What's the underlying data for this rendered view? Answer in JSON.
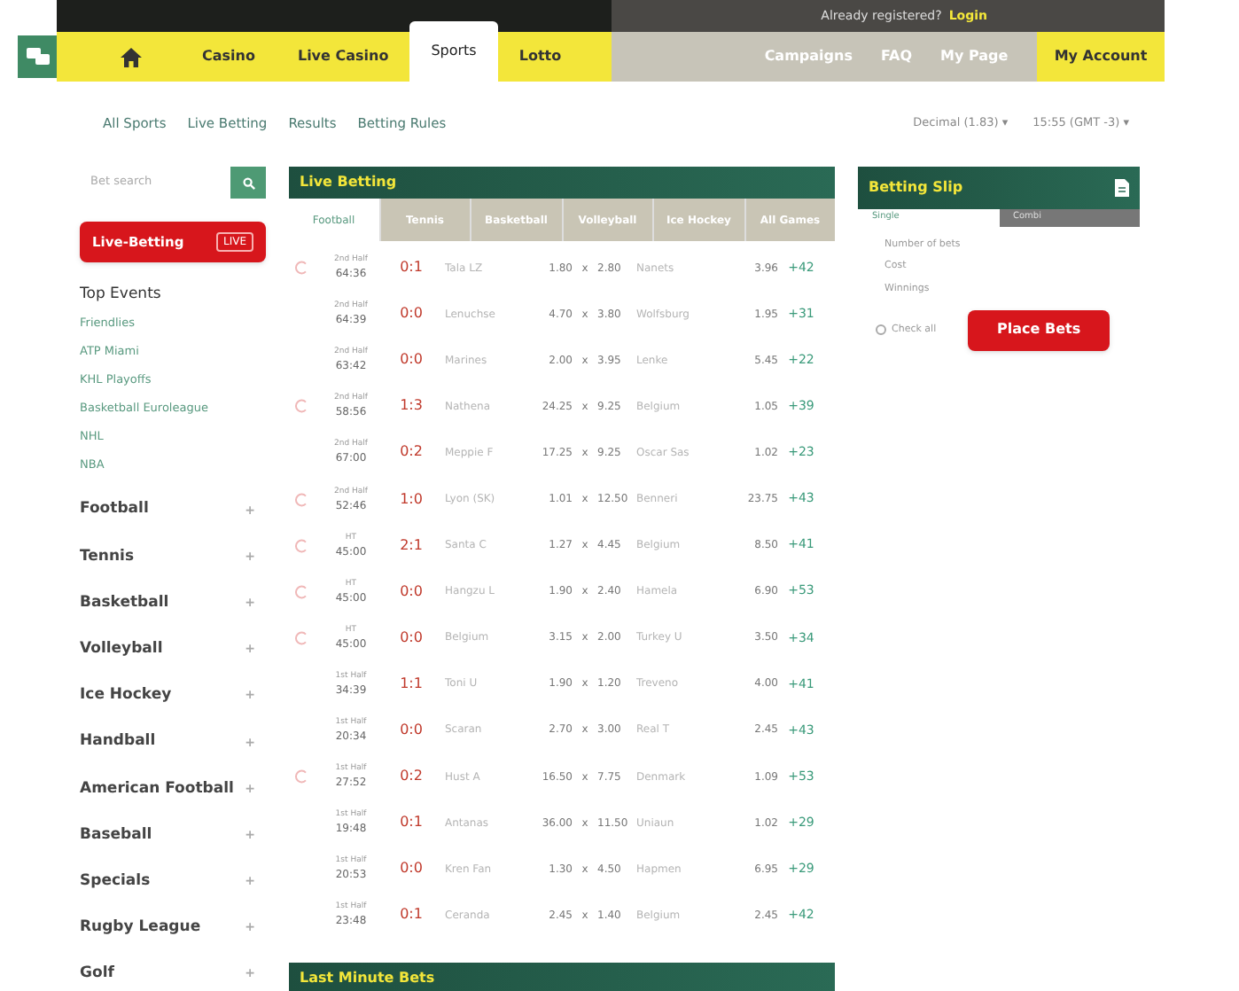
{
  "header": {
    "login_prompt": "Already registered?",
    "login_link": "Login"
  },
  "nav": {
    "main": [
      {
        "kind": "home",
        "selected": false
      },
      {
        "kind": "link",
        "label": "Casino",
        "selected": false
      },
      {
        "kind": "link",
        "label": "Live Casino",
        "selected": false
      },
      {
        "kind": "link",
        "label": "Sports",
        "selected": true
      },
      {
        "kind": "link",
        "label": "Lotto",
        "selected": false
      }
    ],
    "secondary": [
      "Campaigns",
      "FAQ",
      "My Page"
    ],
    "account": "My Account"
  },
  "subnav": {
    "links": [
      "All Sports",
      "Live Betting",
      "Results",
      "Betting Rules"
    ],
    "odds_format": "Decimal (1.83)",
    "odds_caret": "▾",
    "timezone": "15:55 (GMT -3)",
    "timezone_caret": "▾"
  },
  "sidebar": {
    "search": {
      "placeholder": "Bet search"
    },
    "live_button": {
      "label": "Live-Betting",
      "badge": "LIVE"
    },
    "top_events_title": "Top Events",
    "top_events": [
      "Friendlies",
      "ATP Miami",
      "KHL Playoffs",
      "Basketball Euroleague",
      "NHL",
      "NBA"
    ],
    "sports": [
      {
        "label": "Football",
        "expand": "+"
      },
      {
        "label": "Tennis",
        "expand": "+"
      },
      {
        "label": "Basketball",
        "expand": "+"
      },
      {
        "label": "Volleyball",
        "expand": "+"
      },
      {
        "label": "Ice Hockey",
        "expand": "+"
      },
      {
        "label": "Handball",
        "expand": "+"
      },
      {
        "label": "American Football",
        "expand": "+"
      },
      {
        "label": "Baseball",
        "expand": "+"
      },
      {
        "label": "Specials",
        "expand": "+"
      },
      {
        "label": "Rugby League",
        "expand": "+"
      },
      {
        "label": "Golf",
        "expand": "+"
      }
    ]
  },
  "live_betting": {
    "title": "Live Betting",
    "tabs": [
      {
        "label": "Football",
        "selected": true
      },
      {
        "label": "Tennis",
        "selected": false
      },
      {
        "label": "Basketball",
        "selected": false
      },
      {
        "label": "Volleyball",
        "selected": false
      },
      {
        "label": "Ice Hockey",
        "selected": false
      },
      {
        "label": "All Games",
        "selected": false
      }
    ],
    "rows": [
      {
        "stream": true,
        "period": "2nd Half",
        "clock": "64:36",
        "score": "0:1",
        "home": "Tala LZ",
        "odd1": "1.80",
        "x": "x",
        "oddx": "2.80",
        "away": "Nanets",
        "odd2": "3.96",
        "more": "+42"
      },
      {
        "stream": false,
        "period": "2nd Half",
        "clock": "64:39",
        "score": "0:0",
        "home": "Lenuchse",
        "odd1": "4.70",
        "x": "x",
        "oddx": "3.80",
        "away": "Wolfsburg",
        "odd2": "1.95",
        "more": "+31"
      },
      {
        "stream": false,
        "period": "2nd Half",
        "clock": "63:42",
        "score": "0:0",
        "home": "Marines",
        "odd1": "2.00",
        "x": "x",
        "oddx": "3.95",
        "away": "Lenke",
        "odd2": "5.45",
        "more": "+22"
      },
      {
        "stream": true,
        "period": "2nd Half",
        "clock": "58:56",
        "score": "1:3",
        "home": "Nathena",
        "odd1": "24.25",
        "x": "x",
        "oddx": "9.25",
        "away": "Belgium",
        "odd2": "1.05",
        "more": "+39"
      },
      {
        "stream": false,
        "period": "2nd Half",
        "clock": "67:00",
        "score": "0:2",
        "home": "Meppie F",
        "odd1": "17.25",
        "x": "x",
        "oddx": "9.25",
        "away": "Oscar Sas",
        "odd2": "1.02",
        "more": "+23"
      },
      {
        "stream": true,
        "period": "2nd Half",
        "clock": "52:46",
        "score": "1:0",
        "home": "Lyon (SK)",
        "odd1": "1.01",
        "x": "x",
        "oddx": "12.50",
        "away": "Benneri",
        "odd2": "23.75",
        "more": "+43"
      },
      {
        "stream": true,
        "period": "HT",
        "clock": "45:00",
        "score": "2:1",
        "home": "Santa C",
        "odd1": "1.27",
        "x": "x",
        "oddx": "4.45",
        "away": "Belgium",
        "odd2": "8.50",
        "more": "+41"
      },
      {
        "stream": true,
        "period": "HT",
        "clock": "45:00",
        "score": "0:0",
        "home": "Hangzu L",
        "odd1": "1.90",
        "x": "x",
        "oddx": "2.40",
        "away": "Hamela",
        "odd2": "6.90",
        "more": "+53"
      },
      {
        "stream": true,
        "period": "HT",
        "clock": "45:00",
        "score": "0:0",
        "home": "Belgium",
        "odd1": "3.15",
        "x": "x",
        "oddx": "2.00",
        "away": "Turkey U",
        "odd2": "3.50",
        "more": "+34"
      },
      {
        "stream": false,
        "period": "1st Half",
        "clock": "34:39",
        "score": "1:1",
        "home": "Toni U",
        "odd1": "1.90",
        "x": "x",
        "oddx": "1.20",
        "away": "Treveno",
        "odd2": "4.00",
        "more": "+41"
      },
      {
        "stream": false,
        "period": "1st Half",
        "clock": "20:34",
        "score": "0:0",
        "home": "Scaran",
        "odd1": "2.70",
        "x": "x",
        "oddx": "3.00",
        "away": "Real T",
        "odd2": "2.45",
        "more": "+43"
      },
      {
        "stream": true,
        "period": "1st Half",
        "clock": "27:52",
        "score": "0:2",
        "home": "Hust A",
        "odd1": "16.50",
        "x": "x",
        "oddx": "7.75",
        "away": "Denmark",
        "odd2": "1.09",
        "more": "+53"
      },
      {
        "stream": false,
        "period": "1st Half",
        "clock": "19:48",
        "score": "0:1",
        "home": "Antanas",
        "odd1": "36.00",
        "x": "x",
        "oddx": "11.50",
        "away": "Uniaun",
        "odd2": "1.02",
        "more": "+29"
      },
      {
        "stream": false,
        "period": "1st Half",
        "clock": "20:53",
        "score": "0:0",
        "home": "Kren Fan",
        "odd1": "1.30",
        "x": "x",
        "oddx": "4.50",
        "away": "Hapmen",
        "odd2": "6.95",
        "more": "+29"
      },
      {
        "stream": false,
        "period": "1st Half",
        "clock": "23:48",
        "score": "0:1",
        "home": "Ceranda",
        "odd1": "2.45",
        "x": "x",
        "oddx": "1.40",
        "away": "Belgium",
        "odd2": "2.45",
        "more": "+42"
      }
    ]
  },
  "last_minute": {
    "title": "Last Minute Bets"
  },
  "betting_slip": {
    "title": "Betting Slip",
    "tabs": [
      {
        "label": "Single",
        "selected": true
      },
      {
        "label": "Combi",
        "selected": false
      }
    ],
    "lines": [
      "Number of bets",
      "Cost",
      "Winnings"
    ],
    "check_all": {
      "label": "Check all",
      "checked": false
    },
    "place_button": "Place Bets"
  }
}
